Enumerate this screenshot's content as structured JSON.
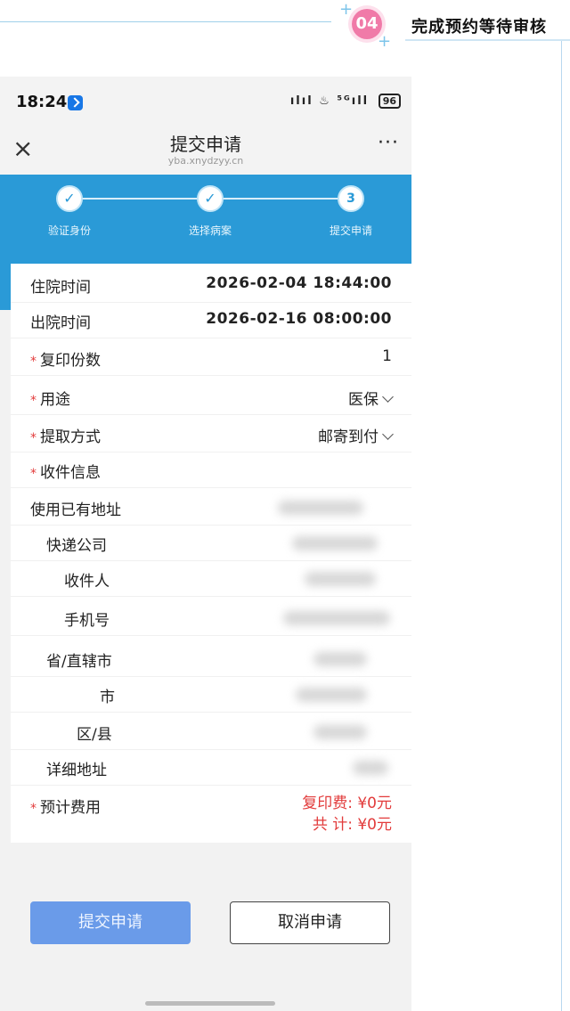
{
  "banner": {
    "step_number": "04",
    "step_title": "完成预约等待审核"
  },
  "statusbar": {
    "time": "18:24",
    "system_icons": "ılıl ♨ ⁵ᴳıll",
    "battery": "96"
  },
  "navbar": {
    "close_icon": "×",
    "title": "提交申请",
    "subtitle": "yba.xnydzyy.cn",
    "more_icon": "···"
  },
  "stepper": {
    "steps": [
      {
        "label": "验证身份",
        "mark": "✓"
      },
      {
        "label": "选择病案",
        "mark": "✓"
      },
      {
        "label": "提交申请",
        "mark": "3"
      }
    ]
  },
  "form": {
    "admission": {
      "label": "住院时间",
      "value": "2026-02-04 18:44:00"
    },
    "discharge": {
      "label": "出院时间",
      "value": "2026-02-16 08:00:00"
    },
    "copies": {
      "required": "*",
      "label": "复印份数",
      "value": "1"
    },
    "purpose": {
      "required": "*",
      "label": "用途",
      "value": "医保"
    },
    "pickup": {
      "required": "*",
      "label": "提取方式",
      "value": "邮寄到付"
    },
    "recipient_info": {
      "required": "*",
      "label": "收件信息"
    },
    "use_existing_address": {
      "label": "使用已有地址"
    },
    "courier": {
      "label": "快递公司"
    },
    "recipient": {
      "label": "收件人"
    },
    "phone": {
      "label": "手机号"
    },
    "province": {
      "label": "省/直辖市"
    },
    "city": {
      "label": "市"
    },
    "district": {
      "label": "区/县"
    },
    "detail_address": {
      "label": "详细地址"
    },
    "fee": {
      "required": "*",
      "label": "预计费用",
      "copy_fee": "复印费:  ¥0元",
      "total": "共    计:  ¥0元"
    }
  },
  "buttons": {
    "submit": "提交申请",
    "cancel": "取消申请"
  },
  "colors": {
    "accent": "#2a9ad7",
    "step_pink": "#f07aa8",
    "required_red": "#e23b3b",
    "submit_blue": "#6a9be9"
  }
}
